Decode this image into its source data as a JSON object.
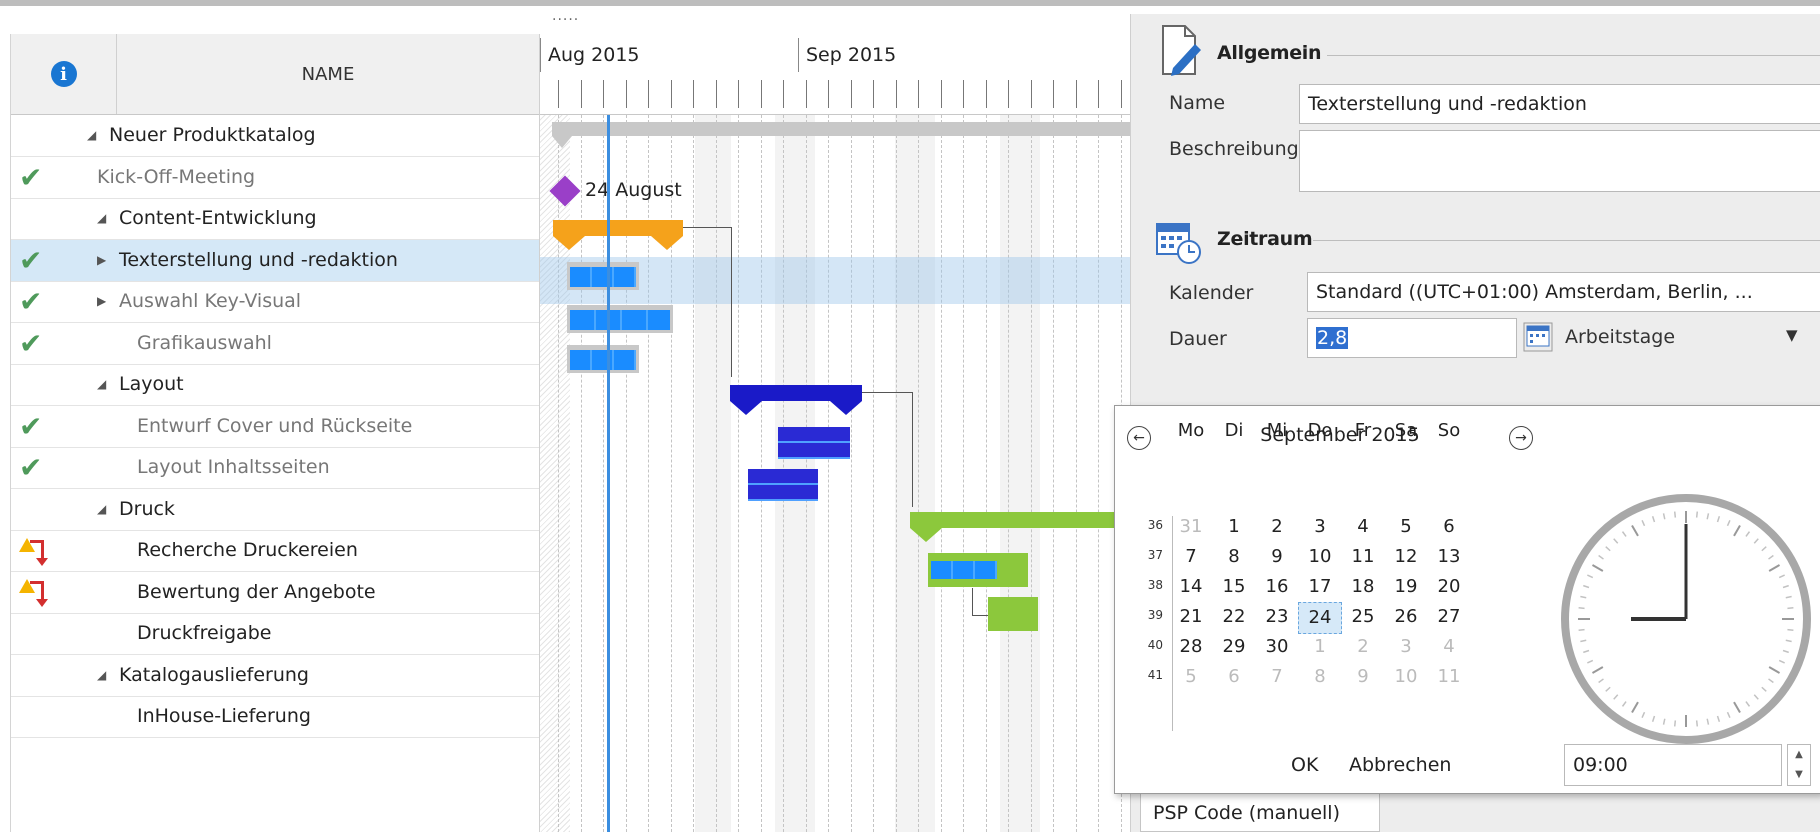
{
  "grid": {
    "header_name": "NAME",
    "rows": [
      {
        "label": "Neuer Produktkatalog",
        "indicator": "",
        "toggle": "◢",
        "level": 0,
        "muted": false,
        "selected": false
      },
      {
        "label": "Kick-Off-Meeting",
        "indicator": "check",
        "toggle": "",
        "level": 1,
        "muted": true,
        "selected": false
      },
      {
        "label": "Content-Entwicklung",
        "indicator": "",
        "toggle": "◢",
        "level": 1,
        "muted": false,
        "selected": false
      },
      {
        "label": "Texterstellung und -redaktion",
        "indicator": "check",
        "toggle": "▶",
        "level": 1,
        "muted": false,
        "selected": true
      },
      {
        "label": "Auswahl Key-Visual",
        "indicator": "check",
        "toggle": "▶",
        "level": 1,
        "muted": true,
        "selected": false
      },
      {
        "label": "Grafikauswahl",
        "indicator": "check",
        "toggle": "",
        "level": 2,
        "muted": true,
        "selected": false
      },
      {
        "label": "Layout",
        "indicator": "",
        "toggle": "◢",
        "level": 1,
        "muted": false,
        "selected": false
      },
      {
        "label": "Entwurf Cover und Rückseite",
        "indicator": "check",
        "toggle": "",
        "level": 2,
        "muted": true,
        "selected": false
      },
      {
        "label": "Layout Inhaltsseiten",
        "indicator": "check",
        "toggle": "",
        "level": 2,
        "muted": true,
        "selected": false
      },
      {
        "label": "Druck",
        "indicator": "",
        "toggle": "◢",
        "level": 1,
        "muted": false,
        "selected": false
      },
      {
        "label": "Recherche Druckereien",
        "indicator": "warn",
        "toggle": "",
        "level": 2,
        "muted": false,
        "selected": false
      },
      {
        "label": "Bewertung der Angebote",
        "indicator": "warn",
        "toggle": "",
        "level": 2,
        "muted": false,
        "selected": false
      },
      {
        "label": "Druckfreigabe",
        "indicator": "",
        "toggle": "",
        "level": 2,
        "muted": false,
        "selected": false
      },
      {
        "label": "Katalogauslieferung",
        "indicator": "",
        "toggle": "◢",
        "level": 1,
        "muted": false,
        "selected": false
      },
      {
        "label": "InHouse-Lieferung",
        "indicator": "",
        "toggle": "",
        "level": 2,
        "muted": false,
        "selected": false
      }
    ]
  },
  "gantt": {
    "handle": "·····",
    "month_aug": "Aug 2015",
    "month_sep": "Sep 2015",
    "milestone_label": "24 August",
    "colors": {
      "summary": "#c8c8c8",
      "content": "#f5a21b",
      "layout": "#1a1ac8",
      "druck": "#8cc83c",
      "task": "#1a8cff",
      "milestone": "#9a3fc8"
    }
  },
  "panel": {
    "allgemein_title": "Allgemein",
    "name_label": "Name",
    "name_value": "Texterstellung und -redaktion",
    "desc_label": "Beschreibung",
    "desc_value": "",
    "zeitraum_title": "Zeitraum",
    "kalender_label": "Kalender",
    "kalender_value": "Standard ((UTC+01:00) Amsterdam, Berlin, ...",
    "dauer_label": "Dauer",
    "dauer_value": "2,8",
    "unit_value": "Arbeitstage",
    "psp_label": "PSP Code (manuell)"
  },
  "calendar": {
    "title": "September 2015",
    "weekdays": [
      "Mo",
      "Di",
      "Mi",
      "Do",
      "Fr",
      "Sa",
      "So"
    ],
    "weeks": [
      {
        "num": "36",
        "days": [
          "31",
          "1",
          "2",
          "3",
          "4",
          "5",
          "6"
        ]
      },
      {
        "num": "37",
        "days": [
          "7",
          "8",
          "9",
          "10",
          "11",
          "12",
          "13"
        ]
      },
      {
        "num": "38",
        "days": [
          "14",
          "15",
          "16",
          "17",
          "18",
          "19",
          "20"
        ]
      },
      {
        "num": "39",
        "days": [
          "21",
          "22",
          "23",
          "24",
          "25",
          "26",
          "27"
        ]
      },
      {
        "num": "40",
        "days": [
          "28",
          "29",
          "30",
          "1",
          "2",
          "3",
          "4"
        ]
      },
      {
        "num": "41",
        "days": [
          "5",
          "6",
          "7",
          "8",
          "9",
          "10",
          "11"
        ]
      }
    ],
    "selected_day": "24",
    "ok_label": "OK",
    "cancel_label": "Abbrechen",
    "time_value": "09:00"
  }
}
